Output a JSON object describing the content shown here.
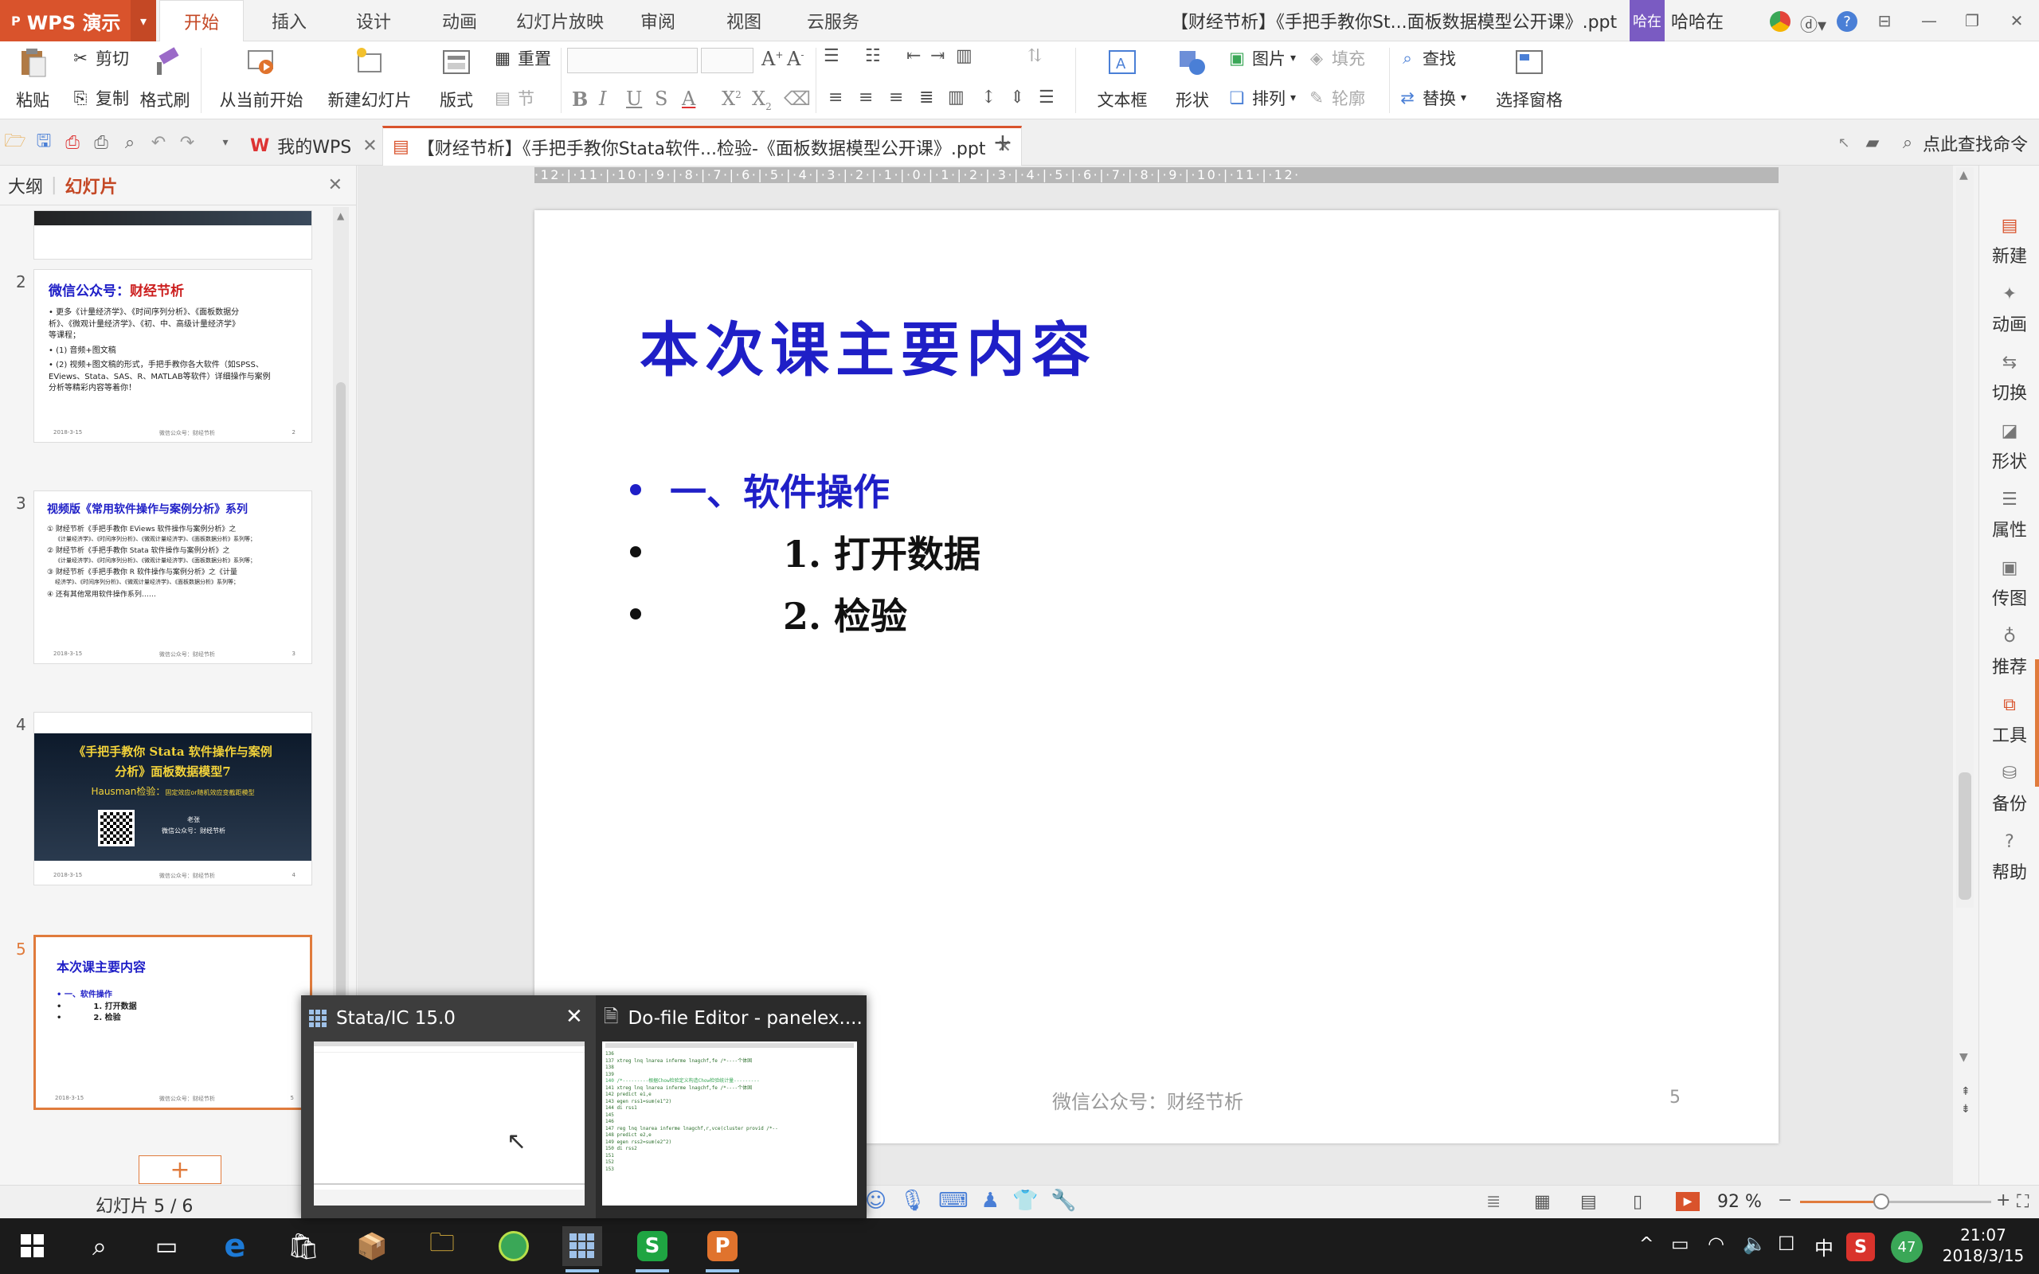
{
  "app": {
    "name": "WPS 演示",
    "doc_title": "【财经节析】《手把手教你St...面板数据模型公开课》.ppt",
    "user_badge": "哈在",
    "user_name": "哈哈在"
  },
  "menu_tabs": [
    "开始",
    "插入",
    "设计",
    "动画",
    "幻灯片放映",
    "审阅",
    "视图",
    "云服务"
  ],
  "ribbon": {
    "paste": "粘贴",
    "cut": "剪切",
    "copy": "复制",
    "format_painter": "格式刷",
    "from_current": "从当前开始",
    "new_slide": "新建幻灯片",
    "layout": "版式",
    "reset": "重置",
    "section": "节",
    "textbox": "文本框",
    "shape": "形状",
    "picture": "图片",
    "fill": "填充",
    "arrange": "排列",
    "outline": "轮廓",
    "find": "查找",
    "replace": "替换",
    "selection_pane": "选择窗格"
  },
  "doc_tabs": {
    "home": "我的WPS",
    "active": "【财经节析】《手把手教你Stata软件...检验-《面板数据模型公开课》.ppt",
    "search": "点此查找命令"
  },
  "left_panel": {
    "tab_outline": "大纲",
    "tab_slides": "幻灯片",
    "thumb2": {
      "num": "2",
      "title_a": "微信公众号：",
      "title_b": "财经节析",
      "l1": "• 更多《计量经济学》、《时间序列分析》、《面板数据分",
      "l2": "  析》、《微观计量经济学》、《初、中、高级计量经济学》",
      "l3": "  等课程；",
      "l4": "• (1) 音频+图文稿",
      "l5": "• (2) 视频+图文稿的形式，手把手教你各大软件（如SPSS、",
      "l6": "  EViews、Stata、SAS、R、MATLAB等软件）详细操作与案例",
      "l7": "  分析等精彩内容等着你！",
      "foot_date": "2018-3-15",
      "foot_center": "微信公众号：财经节析",
      "foot_num": "2"
    },
    "thumb3": {
      "num": "3",
      "title": "视频版《常用软件操作与案例分析》系列",
      "l1": "① 财经节析《手把手教你 EViews 软件操作与案例分析》之",
      "l2": "   《计量经济学》、《时间序列分析》、《微观计量经济学》、《面板数据分析》系列等；",
      "l3": "② 财经节析《手把手教你 Stata 软件操作与案例分析》之",
      "l4": "   《计量经济学》、《时间序列分析》、《微观计量经济学》、《面板数据分析》系列等；",
      "l5": "③ 财经节析《手把手教你 R 软件操作与案例分析》之《计量",
      "l6": "   经济学》、《时间序列分析》、《微观计量经济学》、《面板数据分析》系列等；",
      "l7": "④ 还有其他常用软件操作系列……",
      "foot_date": "2018-3-15",
      "foot_center": "微信公众号：财经节析",
      "foot_num": "3"
    },
    "thumb4": {
      "num": "4",
      "t1": "《手把手教你 Stata 软件操作与案例",
      "t2": "分析》面板数据模型7",
      "t3a": "Hausman检验：",
      "t3b": "固定效应or随机效应变截距模型",
      "author": "老张",
      "wechat": "微信公众号：财经节析",
      "foot_date": "2018-3-15",
      "foot_center": "微信公众号：财经节析",
      "foot_num": "4"
    },
    "thumb5": {
      "num": "5",
      "title": "本次课主要内容",
      "b1": "一、软件操作",
      "b2": "1. 打开数据",
      "b3": "2. 检验",
      "foot_date": "2018-3-15",
      "foot_center": "微信公众号：财经节析",
      "foot_num": "5"
    }
  },
  "slide": {
    "title": "本次课主要内容",
    "bullets": [
      "一、软件操作",
      "1.  打开数据",
      "2.  检验"
    ],
    "footer": "微信公众号：财经节析",
    "page": "5",
    "title_color": "#1f1fc7"
  },
  "ruler_marks": "·12·|·11·|·10·|·9·|·8·|·7·|·6·|·5·|·4·|·3·|·2·|·1·|·0·|·1·|·2·|·3·|·4·|·5·|·6·|·7·|·8·|·9·|·10·|·11·|·12·",
  "right_rail": [
    "新建",
    "动画",
    "切换",
    "形状",
    "属性",
    "传图",
    "推荐",
    "工具",
    "备份",
    "帮助"
  ],
  "status": {
    "slide_info": "幻灯片 5 / 6",
    "zoom": "92 %"
  },
  "preview": {
    "pane1_title": "Stata/IC 15.0",
    "pane2_title": "Do-file Editor - panelex....",
    "code_lines": [
      "136",
      "137  xtreg lnq lnarea inferme lnagchf,fe         /*----个体固",
      "138",
      "139",
      "140  /*---------根据Chow检验定义构造Chow检验统计量---------",
      "141  xtreg lnq lnarea inferme lnagchf,fe         /*----个体固",
      "142  predict e1,e",
      "143  egen rss1=sum(e1^2)",
      "144  di rss1",
      "145",
      "146",
      "147  reg lnq lnarea inferme lnagchf,r,vce(cluster provid   /*--",
      "148  predict e2,e",
      "149  egen rss2=sum(e2^2)",
      "150  di rss2",
      "151",
      "152",
      "153"
    ]
  },
  "taskbar": {
    "time": "21:07",
    "date": "2018/3/15",
    "ime": "中",
    "badge": "47"
  },
  "colors": {
    "accent": "#d9532c",
    "slide_title": "#1f1fc7",
    "red_text": "#cc1f1f"
  }
}
